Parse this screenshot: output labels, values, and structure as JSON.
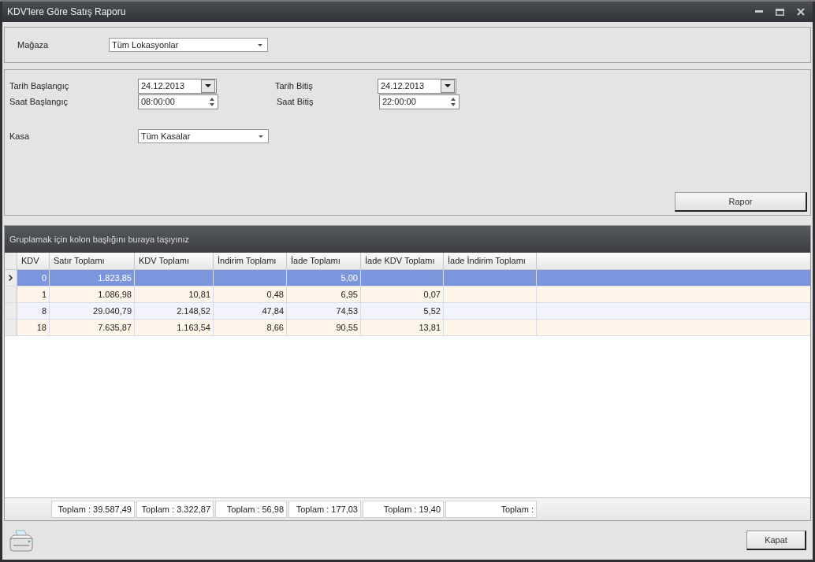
{
  "window": {
    "title": "KDV'lere Göre Satış Raporu"
  },
  "store": {
    "label": "Mağaza",
    "value": "Tüm Lokasyonlar"
  },
  "filters": {
    "start_date": {
      "label": "Tarih Başlangıç",
      "value": "24.12.2013"
    },
    "start_time": {
      "label": "Saat Başlangıç",
      "value": "08:00:00"
    },
    "end_date": {
      "label": "Tarih Bitiş",
      "value": "24.12.2013"
    },
    "end_time": {
      "label": "Saat Bitiş",
      "value": "22:00:00"
    },
    "register": {
      "label": "Kasa",
      "value": "Tüm Kasalar"
    }
  },
  "report_button": "Rapor",
  "grid": {
    "group_hint": "Gruplamak için kolon başlığını buraya taşıyınız",
    "columns": [
      "KDV",
      "Satır Toplamı",
      "KDV Toplamı",
      "İndirim Toplamı",
      "İade Toplamı",
      "İade KDV Toplamı",
      "İade İndirim Toplamı"
    ],
    "rows": [
      {
        "selected": true,
        "cells": [
          "0",
          "1.823,85",
          null,
          null,
          "5,00",
          null,
          null
        ]
      },
      {
        "selected": false,
        "cells": [
          "1",
          "1.086,98",
          "10,81",
          "0,48",
          "6,95",
          "0,07",
          null
        ]
      },
      {
        "selected": false,
        "cells": [
          "8",
          "29.040,79",
          "2.148,52",
          "47,84",
          "74,53",
          "5,52",
          null
        ]
      },
      {
        "selected": false,
        "cells": [
          "18",
          "7.635,87",
          "1.163,54",
          "8,66",
          "90,55",
          "13,81",
          null
        ]
      }
    ],
    "totals": [
      "Toplam : 39.587,49",
      "Toplam : 3.322,87",
      "Toplam : 56,98",
      "Toplam : 177,03",
      "Toplam : 19,40",
      "Toplam :"
    ]
  },
  "close_button": "Kapat"
}
